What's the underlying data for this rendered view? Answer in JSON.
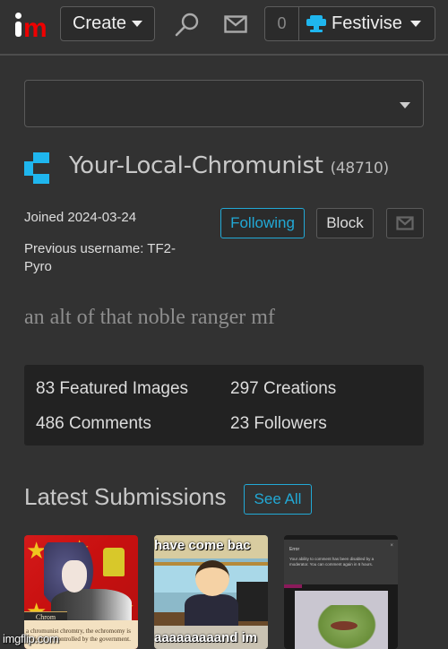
{
  "topbar": {
    "logo_alt": "imgflip",
    "create_label": "Create",
    "search_icon": "search-icon",
    "messages_icon": "mail-icon",
    "notification_count": "0",
    "user_menu_label": "Festivise",
    "user_menu_icon": "tree-icon",
    "accent_color": "#22a9d6",
    "logo_color": "#ee0000"
  },
  "select": {
    "value": "",
    "icon": "chevron-down-icon"
  },
  "profile": {
    "username": "Your-Local-Chromunist",
    "points": "(48710)",
    "avatar_icon": "pixel-c-icon",
    "avatar_color": "#1fb6ee",
    "joined": "Joined 2024-03-24",
    "previous_username": "Previous username: TF2-Pyro",
    "bio": "an alt of that noble ranger mf"
  },
  "actions": {
    "following_label": "Following",
    "block_label": "Block",
    "message_icon": "mail-icon"
  },
  "stats": [
    {
      "label": "83 Featured Images"
    },
    {
      "label": "297 Creations"
    },
    {
      "label": "486 Comments"
    },
    {
      "label": "23 Followers"
    }
  ],
  "latest": {
    "title": "Latest Submissions",
    "see_all_label": "See All",
    "thumbnails": [
      {
        "name_tag": "Chrom",
        "caption": "a chromunist chromtry, the echromomy is basically chrontrolled by the government."
      },
      {
        "top_text": "have come bac",
        "bottom_text": "aaaaaaaaand im"
      },
      {
        "dialog_title": "Error",
        "dialog_message": "Your ability to comment has been disabled by a moderator. You can comment again in 6 hours.",
        "close_glyph": "×"
      }
    ]
  },
  "watermark": "imgflip.com"
}
